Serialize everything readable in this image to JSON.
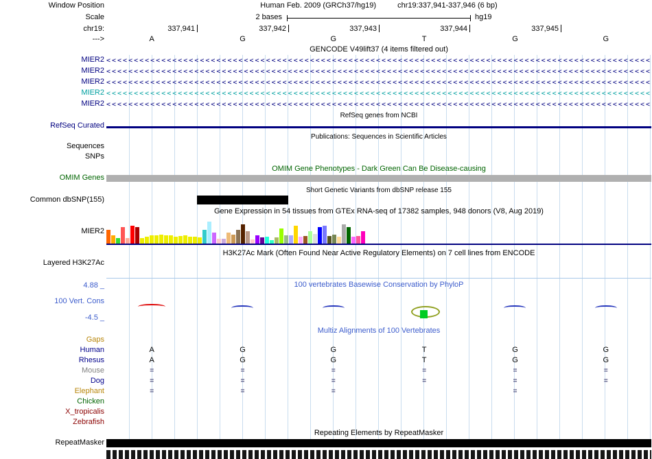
{
  "header": {
    "window_position_label": "Window Position",
    "assembly": "Human Feb. 2009 (GRCh37/hg19)",
    "position": "chr19:337,941-337,946 (6 bp)",
    "scale_label": "Scale",
    "scale_value": "2 bases",
    "genome": "hg19",
    "chrom_label": "chr19:",
    "direction_label": "--->",
    "coordinates": [
      "337,941",
      "337,942",
      "337,943",
      "337,944",
      "337,945"
    ],
    "bases": [
      "A",
      "G",
      "G",
      "T",
      "G",
      "G"
    ]
  },
  "colors": {
    "track_blue": "#000080",
    "gencode_highlight_teal": "#00a0a0",
    "omim_green": "#006400",
    "conservation_blue": "#3c5ccc",
    "omim_bar_gray": "#b0b0b0",
    "grid_blue": "#c8dcee"
  },
  "gencode": {
    "title": "GENCODE V49lift37 (4 items filtered out)",
    "arrow_char": "<",
    "arrow_repeat": 130,
    "items": [
      {
        "label": "MIER2",
        "color": "#000080"
      },
      {
        "label": "MIER2",
        "color": "#000080"
      },
      {
        "label": "MIER2",
        "color": "#000080"
      },
      {
        "label": "MIER2",
        "color": "#00a0a0"
      },
      {
        "label": "MIER2",
        "color": "#000080"
      }
    ]
  },
  "refseq": {
    "title": "RefSeq genes from NCBI",
    "label": "RefSeq Curated"
  },
  "publications": {
    "title": "Publications: Sequences in Scientific Articles",
    "rows": [
      "Sequences",
      "SNPs"
    ]
  },
  "omim": {
    "title": "OMIM Gene Phenotypes - Dark Green Can Be Disease-causing",
    "label": "OMIM Genes"
  },
  "dbsnp": {
    "title": "Short Genetic Variants from dbSNP release 155",
    "label": "Common dbSNP(155)"
  },
  "gtex": {
    "title": "Gene Expression in 54 tissues from GTEx RNA-seq of 17382 samples, 948 donors (V8, Aug 2019)",
    "label": "MIER2"
  },
  "h3k27ac": {
    "title": "H3K27Ac Mark (Often Found Near Active Regulatory Elements) on 7 cell lines from ENCODE",
    "label": "Layered H3K27Ac"
  },
  "conservation": {
    "title": "100 vertebrates Basewise Conservation by PhyloP",
    "label": "100 Vert. Cons",
    "max_label": "4.88 _",
    "min_label": "-4.5 _",
    "marks": [
      {
        "kind": "dip",
        "color": "#dd0000"
      },
      {
        "kind": "flat",
        "color": "#2233bb"
      },
      {
        "kind": "flat",
        "color": "#2233bb"
      },
      {
        "kind": "peak",
        "color": "#90a020",
        "box_color": "#00cc22"
      },
      {
        "kind": "flat",
        "color": "#2233bb"
      },
      {
        "kind": "flat",
        "color": "#2233bb"
      }
    ]
  },
  "multiz": {
    "title": "Multiz Alignments of 100 Vertebrates",
    "rows": [
      {
        "label": "Gaps",
        "color": "#b8860b",
        "cells": [
          "",
          "",
          "",
          "",
          "",
          ""
        ]
      },
      {
        "label": "Human",
        "color": "#00008b",
        "cells": [
          "A",
          "G",
          "G",
          "T",
          "G",
          "G"
        ]
      },
      {
        "label": "Rhesus",
        "color": "#00008b",
        "cells": [
          "A",
          "G",
          "G",
          "T",
          "G",
          "G"
        ]
      },
      {
        "label": "Mouse",
        "color": "#808080",
        "cells": [
          "=",
          "=",
          "=",
          "=",
          "=",
          "="
        ]
      },
      {
        "label": "Dog",
        "color": "#00008b",
        "cells": [
          "=",
          "=",
          "=",
          "=",
          "=",
          "="
        ]
      },
      {
        "label": "Elephant",
        "color": "#b8860b",
        "cells": [
          "=",
          "=",
          "=",
          "",
          "=",
          ""
        ]
      },
      {
        "label": "Chicken",
        "color": "#006400",
        "cells": [
          "",
          "",
          "",
          "",
          "",
          ""
        ]
      },
      {
        "label": "X_tropicalis",
        "color": "#8b0000",
        "cells": [
          "",
          "",
          "",
          "",
          "",
          ""
        ]
      },
      {
        "label": "Zebrafish",
        "color": "#8b0000",
        "cells": [
          "",
          "",
          "",
          "",
          "",
          ""
        ]
      }
    ]
  },
  "repeatmasker": {
    "title": "Repeating Elements by RepeatMasker",
    "label": "RepeatMasker"
  },
  "chart_data": {
    "type": "bar",
    "title": "Gene Expression in 54 tissues from GTEx RNA-seq of 17382 samples, 948 donors (V8, Aug 2019)",
    "gene": "MIER2",
    "values_unit": "relative bar height (px), tissue names not rendered in image",
    "bars": [
      {
        "color": "#ff6600",
        "value": 20
      },
      {
        "color": "#ffaa00",
        "value": 12
      },
      {
        "color": "#33dd33",
        "value": 8
      },
      {
        "color": "#ff5555",
        "value": 24
      },
      {
        "color": "#ffaa99",
        "value": 8
      },
      {
        "color": "#ff0000",
        "value": 26
      },
      {
        "color": "#aa0000",
        "value": 24
      },
      {
        "color": "#eeee00",
        "value": 8
      },
      {
        "color": "#eeee00",
        "value": 10
      },
      {
        "color": "#eeee00",
        "value": 12
      },
      {
        "color": "#eeee00",
        "value": 12
      },
      {
        "color": "#eeee00",
        "value": 13
      },
      {
        "color": "#eeee00",
        "value": 12
      },
      {
        "color": "#eeee00",
        "value": 12
      },
      {
        "color": "#eeee00",
        "value": 10
      },
      {
        "color": "#eeee00",
        "value": 11
      },
      {
        "color": "#eeee00",
        "value": 12
      },
      {
        "color": "#eeee00",
        "value": 10
      },
      {
        "color": "#eeee00",
        "value": 10
      },
      {
        "color": "#eeee00",
        "value": 9
      },
      {
        "color": "#33cccc",
        "value": 20
      },
      {
        "color": "#aaeeff",
        "value": 32
      },
      {
        "color": "#cc66ff",
        "value": 16
      },
      {
        "color": "#ffcccc",
        "value": 7
      },
      {
        "color": "#ccaadd",
        "value": 7
      },
      {
        "color": "#eebb77",
        "value": 16
      },
      {
        "color": "#cc9955",
        "value": 13
      },
      {
        "color": "#8b7355",
        "value": 20
      },
      {
        "color": "#552200",
        "value": 28
      },
      {
        "color": "#bb9988",
        "value": 18
      },
      {
        "color": "#ffcccc",
        "value": 6
      },
      {
        "color": "#9900ff",
        "value": 12
      },
      {
        "color": "#660099",
        "value": 9
      },
      {
        "color": "#22ffdd",
        "value": 10
      },
      {
        "color": "#33ffc2",
        "value": 5
      },
      {
        "color": "#aabb66",
        "value": 9
      },
      {
        "color": "#99ff00",
        "value": 22
      },
      {
        "color": "#99bb88",
        "value": 12
      },
      {
        "color": "#aaaaff",
        "value": 12
      },
      {
        "color": "#ffd700",
        "value": 26
      },
      {
        "color": "#ffaaff",
        "value": 10
      },
      {
        "color": "#995522",
        "value": 11
      },
      {
        "color": "#aaff99",
        "value": 18
      },
      {
        "color": "#dddddd",
        "value": 14
      },
      {
        "color": "#0000ff",
        "value": 24
      },
      {
        "color": "#7777ff",
        "value": 26
      },
      {
        "color": "#555522",
        "value": 11
      },
      {
        "color": "#778855",
        "value": 13
      },
      {
        "color": "#ffdd99",
        "value": 10
      },
      {
        "color": "#aaaaaa",
        "value": 28
      },
      {
        "color": "#006600",
        "value": 24
      },
      {
        "color": "#ff66ff",
        "value": 10
      },
      {
        "color": "#ff5599",
        "value": 11
      },
      {
        "color": "#ff00bb",
        "value": 18
      }
    ]
  }
}
